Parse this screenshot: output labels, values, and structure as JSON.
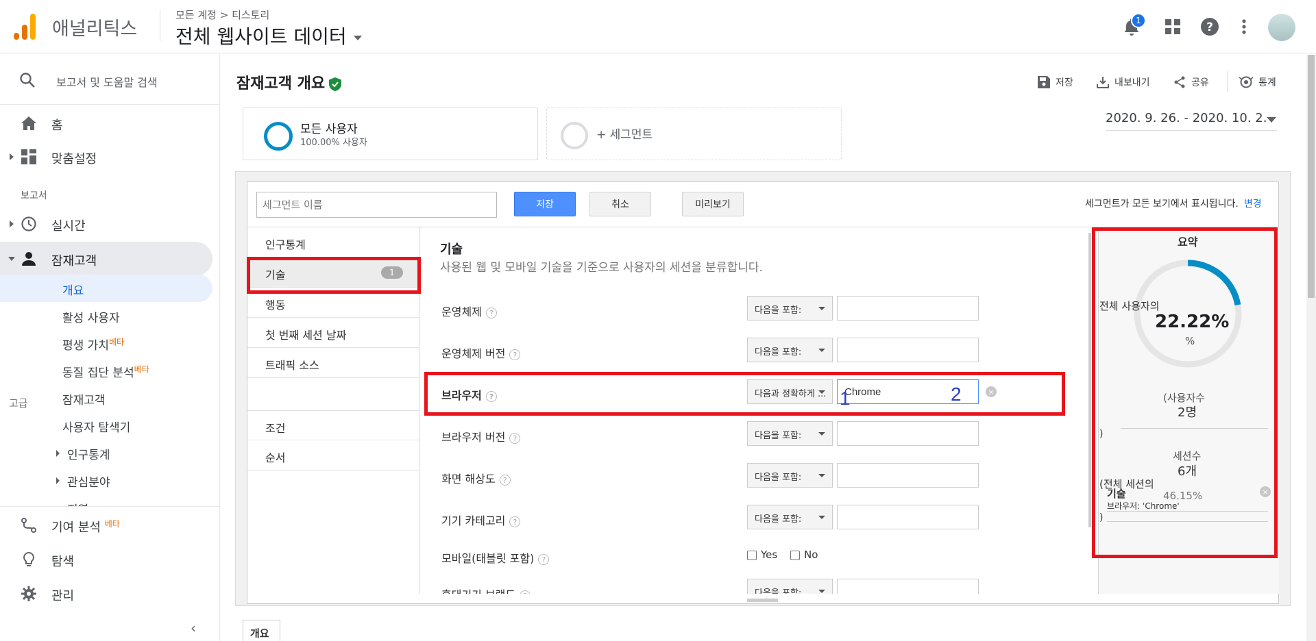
{
  "header": {
    "app_name": "애널리틱스",
    "breadcrumb": "모든 계정 > 티스토리",
    "property_name": "전체 웹사이트 데이터",
    "notification_count": "1"
  },
  "sidebar": {
    "search_text": "보고서 및 도움말 검색",
    "home": "홈",
    "customization": "맞춤설정",
    "reports_label": "보고서",
    "realtime": "실시간",
    "audience": "잠재고객",
    "audience_items": [
      {
        "label": "개요"
      },
      {
        "label": "활성 사용자"
      },
      {
        "label": "평생 가치",
        "badge": "베타"
      },
      {
        "label": "동질 집단 분석",
        "badge": "베타"
      },
      {
        "label": "잠재고객"
      },
      {
        "label": "사용자 탐색기"
      },
      {
        "label": "인구통계"
      },
      {
        "label": "관심분야"
      },
      {
        "label": "지역"
      }
    ],
    "attribution": "기여 분석",
    "attribution_badge": "베타",
    "discover": "탐색",
    "admin": "관리",
    "collapse_glyph": "‹"
  },
  "page": {
    "title": "잠재고객 개요",
    "toolbar": {
      "save": "저장",
      "export": "내보내기",
      "share": "공유",
      "insights": "통계"
    },
    "segment": {
      "name": "모든 사용자",
      "sub": "100.00% 사용자"
    },
    "add_segment": "+ 세그먼트",
    "date_range": "2020. 9. 26. - 2020. 10. 2.",
    "bottom_tab": "개요"
  },
  "editor": {
    "name_placeholder": "세그먼트 이름",
    "save": "저장",
    "cancel": "취소",
    "preview": "미리보기",
    "shown_note": "세그먼트가 모든 보기에서 표시됩니다.",
    "shown_change": "변경",
    "categories": [
      {
        "label": "인구통계"
      },
      {
        "label": "기술",
        "badge": "1"
      },
      {
        "label": "행동"
      },
      {
        "label": "첫 번째 세션 날짜"
      },
      {
        "label": "트래픽 소스"
      }
    ],
    "advanced_label": "고급",
    "advanced": [
      {
        "label": "조건"
      },
      {
        "label": "순서"
      }
    ],
    "form_title": "기술",
    "form_desc": "사용된 웹 및 모바일 기술을 기준으로 사용자의 세션을 분류합니다.",
    "help_glyph": "?",
    "clear_glyph": "×",
    "rows": [
      {
        "label": "운영체제",
        "operator": "다음을 포함:",
        "value": ""
      },
      {
        "label": "운영체제 버전",
        "operator": "다음을 포함:",
        "value": ""
      },
      {
        "label": "브라우저",
        "operator": "다음과 정확하게 ...",
        "value": "Chrome"
      },
      {
        "label": "브라우저 버전",
        "operator": "다음을 포함:",
        "value": ""
      },
      {
        "label": "화면 해상도",
        "operator": "다음을 포함:",
        "value": ""
      },
      {
        "label": "기기 카테고리",
        "operator": "다음을 포함:",
        "value": ""
      },
      {
        "label": "모바일(태블릿 포함)",
        "yes": "Yes",
        "no": "No"
      },
      {
        "label": "휴대기기 브랜드",
        "operator": "다음을 포함:",
        "value": ""
      }
    ]
  },
  "summary": {
    "title": "요약",
    "label_users_of": "전체 사용자의",
    "percent": "22.22%",
    "percent_sign": "%",
    "percent_fraction": 0.2222,
    "users_label": "(사용자수",
    "users_value": "2명",
    "paren_close": ")",
    "sessions_label": "세션수",
    "sessions_value": "6개",
    "label_sessions_of": "(전체 세션의",
    "sessions_percent": "46.15%",
    "condition_title": "기술",
    "condition": "브라우저: 'Chrome'"
  },
  "annotations": {
    "num1": "1",
    "num2": "2",
    "color": "#e8141c"
  },
  "colors": {
    "accent": "#058dc7",
    "primary_button": "#4d90fe",
    "beta": "#e8710a"
  }
}
